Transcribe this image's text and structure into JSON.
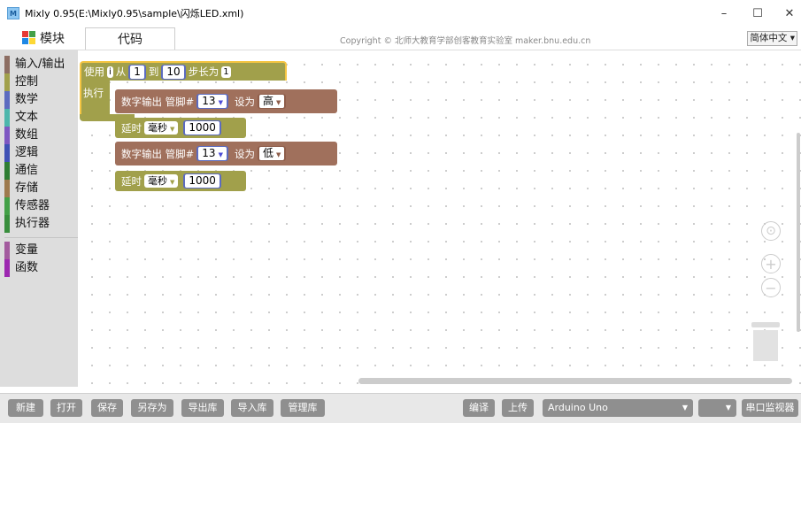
{
  "window": {
    "title": "Mixly 0.95(E:\\Mixly0.95\\sample\\闪烁LED.xml)",
    "app_icon_text": "M",
    "minimize": "–",
    "maximize": "☐",
    "close": "✕"
  },
  "tabs": {
    "blocks_label": "模块",
    "code_label": "代码"
  },
  "copyright": "Copyright © 北师大教育学部创客教育实验室 maker.bnu.edu.cn",
  "language": "简体中文 ▾",
  "toolbox": {
    "categories": [
      {
        "label": "输入/输出",
        "color": "#8d6e63"
      },
      {
        "label": "控制",
        "color": "#a1a04b"
      },
      {
        "label": "数学",
        "color": "#5c6bc0"
      },
      {
        "label": "文本",
        "color": "#4db6ac"
      },
      {
        "label": "数组",
        "color": "#7e57c2"
      },
      {
        "label": "逻辑",
        "color": "#3f51b5"
      },
      {
        "label": "通信",
        "color": "#2e7d32"
      },
      {
        "label": "存储",
        "color": "#9e7a4e"
      },
      {
        "label": "传感器",
        "color": "#43a047"
      },
      {
        "label": "执行器",
        "color": "#388e3c"
      },
      {
        "label": "变量",
        "color": "#a35b9e"
      },
      {
        "label": "函数",
        "color": "#9c27b0"
      }
    ]
  },
  "blocks": {
    "loop": {
      "use_label": "使用",
      "var_name": "i",
      "from_label": "从",
      "from_value": "1",
      "to_label": "到",
      "to_value": "10",
      "step_label": "步长为",
      "step_value": "1",
      "exec_label": "执行"
    },
    "digital_write_1": {
      "label": "数字输出 管脚#",
      "pin": "13",
      "set_label": "设为",
      "value": "高"
    },
    "delay_1": {
      "label": "延时",
      "unit": "毫秒",
      "value": "1000"
    },
    "digital_write_2": {
      "label": "数字输出 管脚#",
      "pin": "13",
      "set_label": "设为",
      "value": "低"
    },
    "delay_2": {
      "label": "延时",
      "unit": "毫秒",
      "value": "1000"
    },
    "dropdown_arrow": "▼"
  },
  "controls": {
    "center": "⊙",
    "zoom_in": "+",
    "zoom_out": "−"
  },
  "bottom_toolbar": {
    "new": "新建",
    "open": "打开",
    "save": "保存",
    "save_as": "另存为",
    "export_lib": "导出库",
    "import_lib": "导入库",
    "manage_lib": "管理库",
    "compile": "编译",
    "upload": "上传",
    "board": "Arduino Uno",
    "port": "",
    "serial_monitor": "串口监视器",
    "arrow": "▼"
  },
  "colors": {
    "loop_block": "#a1a04b",
    "io_block": "#a0705c",
    "math_block": "#5c6bc0",
    "selection": "#f5c542"
  }
}
